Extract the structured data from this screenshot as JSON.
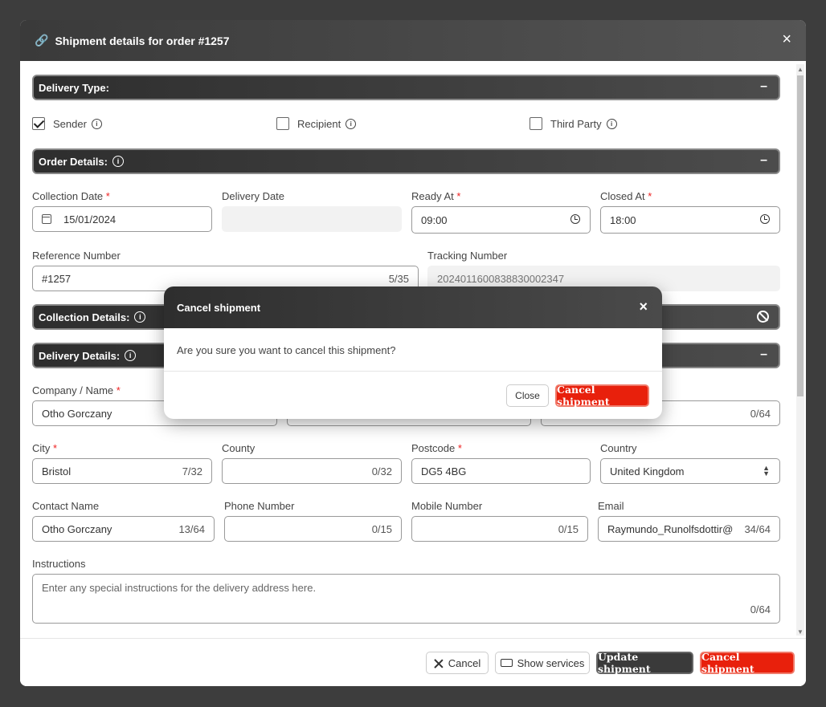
{
  "modal": {
    "title": "Shipment details for order #1257",
    "close": "×"
  },
  "sections": {
    "delivery_type": "Delivery Type:",
    "order_details": "Order Details:",
    "collection_details": "Collection Details:",
    "delivery_details": "Delivery Details:",
    "collapse_symbol": "–"
  },
  "delivery_type": {
    "sender": {
      "label": "Sender",
      "checked": true
    },
    "recipient": {
      "label": "Recipient",
      "checked": false
    },
    "third_party": {
      "label": "Third Party",
      "checked": false
    }
  },
  "order": {
    "collection_date": {
      "label": "Collection Date",
      "value": "15/01/2024"
    },
    "delivery_date": {
      "label": "Delivery Date",
      "value": ""
    },
    "ready_at": {
      "label": "Ready At",
      "value": "09:00"
    },
    "closed_at": {
      "label": "Closed At",
      "value": "18:00"
    },
    "reference_number": {
      "label": "Reference Number",
      "value": "#1257",
      "counter": "5/35"
    },
    "tracking_number": {
      "label": "Tracking Number",
      "value": "20240116008388300023​47"
    }
  },
  "delivery": {
    "company_name": {
      "label": "Company / Name",
      "value": "Otho Gorczany"
    },
    "addr_counter": "0/64",
    "city": {
      "label": "City",
      "value": "Bristol",
      "counter": "7/32"
    },
    "county": {
      "label": "County",
      "value": "",
      "counter": "0/32"
    },
    "postcode": {
      "label": "Postcode",
      "value": "DG5 4BG"
    },
    "country": {
      "label": "Country",
      "value": "United Kingdom"
    },
    "contact_name": {
      "label": "Contact Name",
      "value": "Otho Gorczany",
      "counter": "13/64"
    },
    "phone": {
      "label": "Phone Number",
      "value": "",
      "counter": "0/15"
    },
    "mobile": {
      "label": "Mobile Number",
      "value": "",
      "counter": "0/15"
    },
    "email": {
      "label": "Email",
      "value": "Raymundo_Runolfsdottir@",
      "counter": "34/64"
    },
    "instructions": {
      "label": "Instructions",
      "placeholder": "Enter any special instructions for the delivery address here.",
      "counter": "0/64"
    }
  },
  "footer": {
    "cancel": "Cancel",
    "show_services": "Show services",
    "update_shipment": "Update shipment",
    "cancel_shipment": "Cancel shipment"
  },
  "dialog": {
    "title": "Cancel shipment",
    "close": "×",
    "message": "Are you sure you want to cancel this shipment?",
    "close_button": "Close",
    "confirm_button": "Cancel shipment"
  },
  "colors": {
    "accent_red": "#e8200c",
    "header_dark": "#3a3a3a"
  }
}
